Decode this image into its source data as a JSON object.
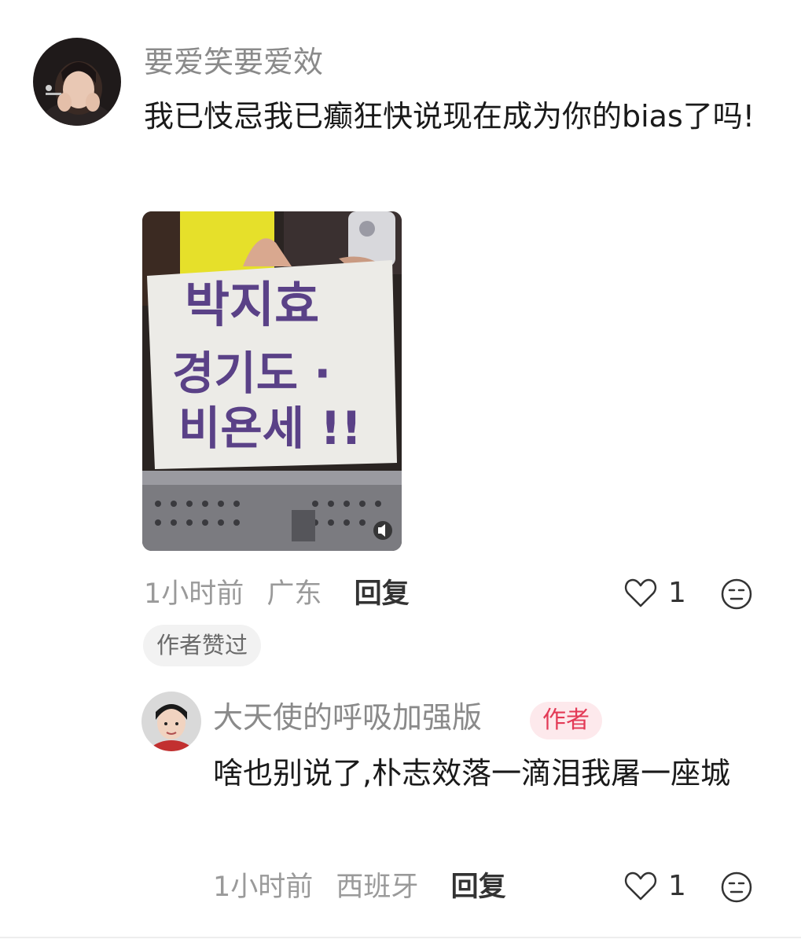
{
  "comment": {
    "username": "要爱笑要爱效",
    "text": "我已忮忌我已癫狂快说现在成为你的bias了吗!",
    "photo": {
      "sign_line1": "박지효",
      "sign_line2": "경기도 ·",
      "sign_line3": "비욘세 !!",
      "speaker_icon": "speaker-icon"
    },
    "time": "1小时前",
    "location": "广东",
    "reply_label": "回复",
    "like_count": "1",
    "liked_by_author_label": "作者赞过"
  },
  "reply": {
    "username": "大天使的呼吸加强版",
    "badge": "作者",
    "text": "啥也别说了,朴志效落一滴泪我屠一座城",
    "time": "1小时前",
    "location": "西班牙",
    "reply_label": "回复",
    "like_count": "1"
  },
  "icons": {
    "like": "heart-outline-icon",
    "dislike": "neutral-face-icon"
  },
  "colors": {
    "username": "#8a8a8a",
    "author_badge_bg": "#fde9ec",
    "author_badge_text": "#e33a56",
    "pill_bg": "#f2f2f2"
  }
}
